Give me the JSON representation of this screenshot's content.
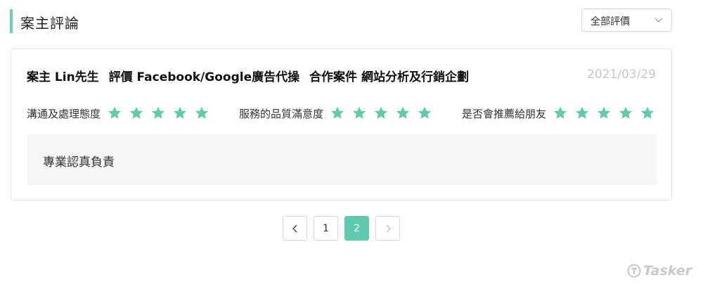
{
  "section": {
    "title": "案主評論"
  },
  "filter": {
    "selected": "全部評價"
  },
  "review": {
    "title_parts": [
      "案主 Lin先生",
      "評價 Facebook/Google廣告代操",
      "合作案件 網站分析及行銷企劃"
    ],
    "date": "2021/03/29",
    "ratings": [
      {
        "label": "溝通及處理態度",
        "stars": 5
      },
      {
        "label": "服務的品質滿意度",
        "stars": 5
      },
      {
        "label": "是否會推薦給朋友",
        "stars": 5
      }
    ],
    "comment": "專業認真負責"
  },
  "pagination": {
    "pages": [
      "1",
      "2"
    ],
    "current": "2"
  },
  "brand": {
    "name": "Tasker"
  },
  "colors": {
    "accent": "#5ecbae",
    "date": "#c8c8c8",
    "comment_bg": "#f6f6f6"
  }
}
